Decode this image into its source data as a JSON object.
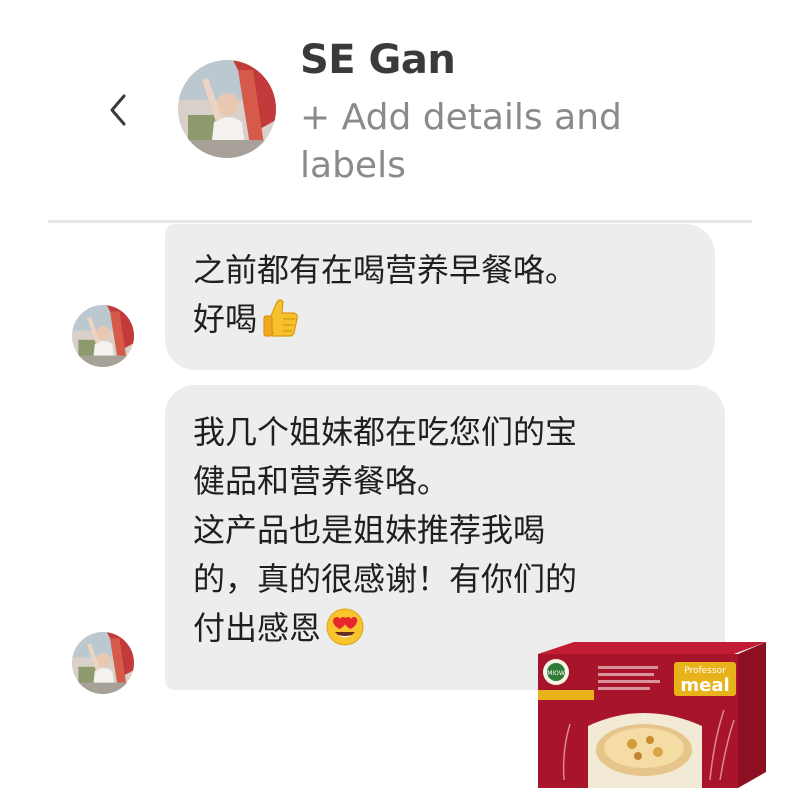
{
  "header": {
    "back_icon": "chevron-left-icon",
    "contact_name": "SE Gan",
    "add_details_label": "+ Add details and labels"
  },
  "messages": [
    {
      "lines": [
        "之前都有在喝营养早餐咯。",
        "好喝"
      ],
      "trailing_emoji": "thumbs-up-icon"
    },
    {
      "lines": [
        "我几个姐妹都在吃您们的宝",
        "健品和营养餐咯。",
        "这产品也是姐妹推荐我喝",
        "的，真的很感谢！有你们的",
        "付出感恩"
      ],
      "trailing_emoji": "heart-eyes-face-icon"
    }
  ],
  "product": {
    "brand_top": "Professor",
    "brand_main": "meal",
    "logo_text": "MIOW",
    "colors": {
      "box_red": "#a8142a",
      "box_gold": "#e7b21a",
      "box_cream": "#f3ead6"
    }
  },
  "colors": {
    "bubble_bg": "#ededed",
    "text": "#1f1f1f",
    "name_text": "#3a3a3a",
    "secondary_text": "#8a8a8a"
  }
}
